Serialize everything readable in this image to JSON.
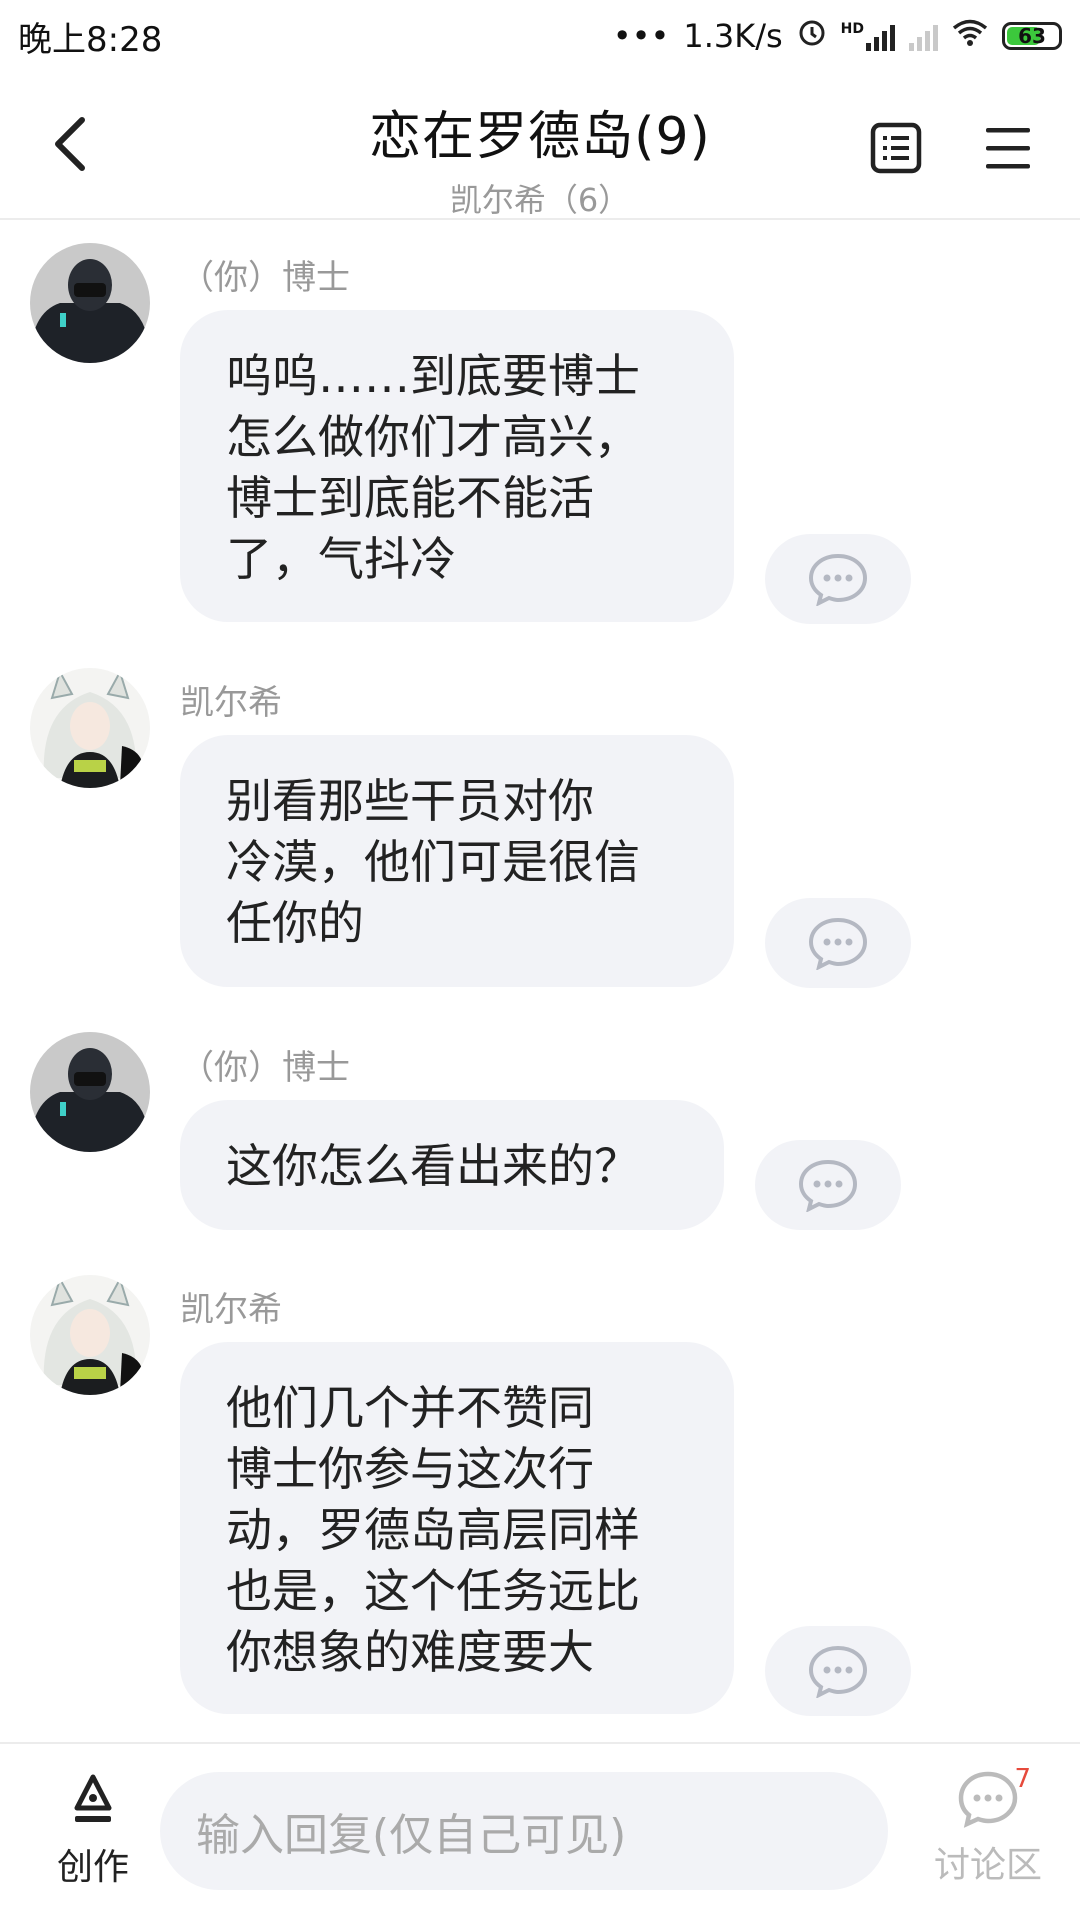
{
  "status": {
    "time": "晚上8:28",
    "speed": "1.3K/s",
    "hd": "HD",
    "battery": "63"
  },
  "header": {
    "title": "恋在罗德岛(9)",
    "subtitle": "凯尔希（6）"
  },
  "messages": [
    {
      "sender": "（你）博士",
      "text": "呜呜……到底要博士\n怎么做你们才高兴，\n博士到底能不能活\n了，气抖冷"
    },
    {
      "sender": "凯尔希",
      "text": "别看那些干员对你\n冷漠，他们可是很信\n任你的"
    },
    {
      "sender": "（你）博士",
      "text": "这你怎么看出来的？"
    },
    {
      "sender": "凯尔希",
      "text": "他们几个并不赞同\n博士你参与这次行\n动，罗德岛高层同样\n也是，这个任务远比\n你想象的难度要大"
    }
  ],
  "bottom": {
    "create_label": "创作",
    "input_placeholder": "输入回复(仅自己可见)",
    "discuss_label": "讨论区",
    "discuss_badge": "7"
  },
  "colors": {
    "bubble": "#f2f3f7",
    "badge": "#e64a3c",
    "battery_fill": "#3cc83c"
  }
}
